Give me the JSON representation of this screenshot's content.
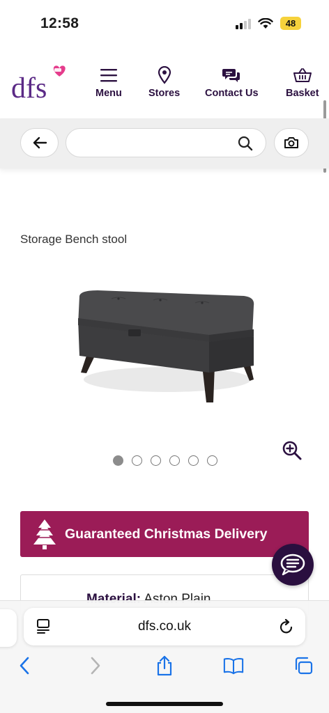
{
  "status_bar": {
    "time": "12:58",
    "battery": "48"
  },
  "header": {
    "logo_text": "dfs",
    "nav": [
      {
        "label": "Menu",
        "icon": "menu-icon"
      },
      {
        "label": "Stores",
        "icon": "location-pin-icon"
      },
      {
        "label": "Contact Us",
        "icon": "chat-bubbles-icon"
      },
      {
        "label": "Basket",
        "icon": "basket-icon"
      }
    ]
  },
  "search": {
    "value": "",
    "placeholder": ""
  },
  "product": {
    "title": "Storage Bench stool",
    "image_count": 6,
    "active_image": 1
  },
  "banner": {
    "text": "Guaranteed Christmas Delivery"
  },
  "details": {
    "material_label": "Material:",
    "material_value": "Aston Plain"
  },
  "browser": {
    "url": "dfs.co.uk"
  },
  "colors": {
    "brand_purple": "#5b2a86",
    "banner": "#9b1c57",
    "nav_text": "#2b1040",
    "chat_button": "#2a0f3f",
    "ios_blue": "#1a73e8"
  }
}
